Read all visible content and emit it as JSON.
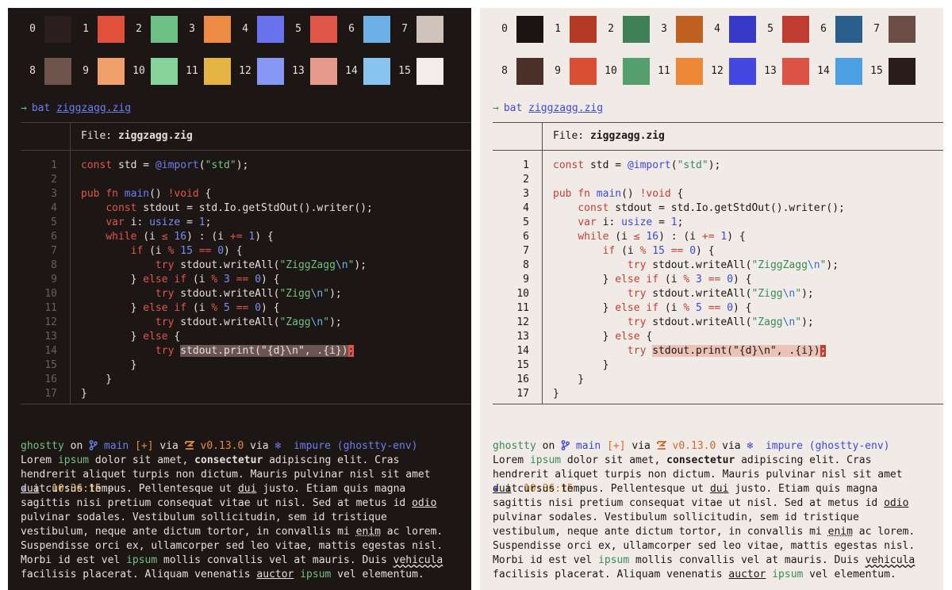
{
  "palette": {
    "dark": {
      "rows": [
        [
          [
            "0",
            "#2a1f1d"
          ],
          [
            "1",
            "#e0503a"
          ],
          [
            "2",
            "#6ec085"
          ],
          [
            "3",
            "#ed8a43"
          ],
          [
            "4",
            "#6673ec"
          ],
          [
            "5",
            "#e0574a"
          ],
          [
            "6",
            "#6cb0e6"
          ],
          [
            "7",
            "#cfc3bc"
          ]
        ],
        [
          [
            "8",
            "#6e544c"
          ],
          [
            "9",
            "#f0a06a"
          ],
          [
            "10",
            "#86d49c"
          ],
          [
            "11",
            "#e6b442"
          ],
          [
            "12",
            "#8797f4"
          ],
          [
            "13",
            "#e69a8b"
          ],
          [
            "14",
            "#88c4ee"
          ],
          [
            "15",
            "#f3ecea"
          ]
        ]
      ]
    },
    "light": {
      "rows": [
        [
          [
            "0",
            "#1c1412"
          ],
          [
            "1",
            "#b63b27"
          ],
          [
            "2",
            "#3f8157"
          ],
          [
            "3",
            "#bf5f22"
          ],
          [
            "4",
            "#3638c8"
          ],
          [
            "5",
            "#be3d30"
          ],
          [
            "6",
            "#2a5e8c"
          ],
          [
            "7",
            "#6a4d45"
          ]
        ],
        [
          [
            "8",
            "#4a3029"
          ],
          [
            "9",
            "#d84f36"
          ],
          [
            "10",
            "#55a06c"
          ],
          [
            "11",
            "#ec8838"
          ],
          [
            "12",
            "#4548e0"
          ],
          [
            "13",
            "#dc5346"
          ],
          [
            "14",
            "#4aa0e2"
          ],
          [
            "15",
            "#2a1c19"
          ]
        ]
      ]
    }
  },
  "command": {
    "arrow": "→",
    "cmd": "bat",
    "file": "ziggzagg.zig"
  },
  "bat": {
    "file_label": "File:",
    "file_name": "ziggzagg.zig"
  },
  "code_lines": [
    [
      [
        "const",
        "kw"
      ],
      [
        " std = ",
        ""
      ],
      [
        "@import",
        "fn"
      ],
      [
        "(",
        ""
      ],
      [
        "\"std\"",
        "str"
      ],
      [
        ");",
        ""
      ]
    ],
    [],
    [
      [
        "pub",
        "kw"
      ],
      [
        " ",
        ""
      ],
      [
        "fn",
        "kw"
      ],
      [
        " ",
        ""
      ],
      [
        "main",
        "fn"
      ],
      [
        "() ",
        ""
      ],
      [
        "!void",
        "kw"
      ],
      [
        " {",
        ""
      ]
    ],
    [
      [
        "    ",
        ""
      ],
      [
        "const",
        "kw"
      ],
      [
        " stdout = std.Io.getStdOut().writer();",
        ""
      ]
    ],
    [
      [
        "    ",
        ""
      ],
      [
        "var",
        "kw"
      ],
      [
        " i: ",
        ""
      ],
      [
        "usize",
        "ty"
      ],
      [
        " = ",
        ""
      ],
      [
        "1",
        "num"
      ],
      [
        ";",
        ""
      ]
    ],
    [
      [
        "    ",
        ""
      ],
      [
        "while",
        "kw"
      ],
      [
        " (i ",
        ""
      ],
      [
        "≤",
        "op"
      ],
      [
        " ",
        ""
      ],
      [
        "16",
        "num"
      ],
      [
        ") : (i ",
        ""
      ],
      [
        "+=",
        "op"
      ],
      [
        " ",
        ""
      ],
      [
        "1",
        "num"
      ],
      [
        ") {",
        ""
      ]
    ],
    [
      [
        "        ",
        ""
      ],
      [
        "if",
        "kw"
      ],
      [
        " (i ",
        ""
      ],
      [
        "%",
        "op"
      ],
      [
        " ",
        ""
      ],
      [
        "15",
        "num"
      ],
      [
        " ",
        ""
      ],
      [
        "==",
        "op"
      ],
      [
        " ",
        ""
      ],
      [
        "0",
        "num"
      ],
      [
        ") {",
        ""
      ]
    ],
    [
      [
        "            ",
        ""
      ],
      [
        "try",
        "kw"
      ],
      [
        " stdout.writeAll(",
        ""
      ],
      [
        "\"ZiggZagg",
        "str"
      ],
      [
        "\\n",
        "esc"
      ],
      [
        "\"",
        "str"
      ],
      [
        ");",
        ""
      ]
    ],
    [
      [
        "        } ",
        ""
      ],
      [
        "else if",
        "kw"
      ],
      [
        " (i ",
        ""
      ],
      [
        "%",
        "op"
      ],
      [
        " ",
        ""
      ],
      [
        "3",
        "num"
      ],
      [
        " ",
        ""
      ],
      [
        "==",
        "op"
      ],
      [
        " ",
        ""
      ],
      [
        "0",
        "num"
      ],
      [
        ") {",
        ""
      ]
    ],
    [
      [
        "            ",
        ""
      ],
      [
        "try",
        "kw"
      ],
      [
        " stdout.writeAll(",
        ""
      ],
      [
        "\"Zigg",
        "str"
      ],
      [
        "\\n",
        "esc"
      ],
      [
        "\"",
        "str"
      ],
      [
        ");",
        ""
      ]
    ],
    [
      [
        "        } ",
        ""
      ],
      [
        "else if",
        "kw"
      ],
      [
        " (i ",
        ""
      ],
      [
        "%",
        "op"
      ],
      [
        " ",
        ""
      ],
      [
        "5",
        "num"
      ],
      [
        " ",
        ""
      ],
      [
        "==",
        "op"
      ],
      [
        " ",
        ""
      ],
      [
        "0",
        "num"
      ],
      [
        ") {",
        ""
      ]
    ],
    [
      [
        "            ",
        ""
      ],
      [
        "try",
        "kw"
      ],
      [
        " stdout.writeAll(",
        ""
      ],
      [
        "\"Zagg",
        "str"
      ],
      [
        "\\n",
        "esc"
      ],
      [
        "\"",
        "str"
      ],
      [
        ");",
        ""
      ]
    ],
    [
      [
        "        } ",
        ""
      ],
      [
        "else",
        "kw"
      ],
      [
        " {",
        ""
      ]
    ],
    [
      [
        "            ",
        ""
      ],
      [
        "try",
        "kw"
      ],
      [
        " ",
        ""
      ],
      [
        "stdout.print(\"{d}\\n\", .{i})",
        "sel"
      ],
      [
        ";",
        "cur"
      ]
    ],
    [
      [
        "        }",
        ""
      ]
    ],
    [
      [
        "    }",
        ""
      ]
    ],
    [
      [
        "}",
        ""
      ]
    ]
  ],
  "status": {
    "dir": "ghostty",
    "on": " on ",
    "branch_icon": "branch-icon",
    "branch": " main",
    "changes": " [+]",
    "via1": " via ",
    "zig_icon": "zig-icon",
    "zig": " v0.13.0",
    "via2": " via ",
    "nix_icon": "snowflake-icon",
    "nix": "  impure (ghostty-env)",
    "at_star": "✦",
    "at": " at ",
    "time": "10:36:15",
    "arrow": " →"
  },
  "lorem": [
    [
      [
        "Lorem ",
        ""
      ],
      [
        "ipsum",
        "green"
      ],
      [
        " dolor sit amet, ",
        ""
      ],
      [
        "consectetur",
        "b"
      ],
      [
        " adipiscing elit. Cras",
        ""
      ]
    ],
    [
      [
        "hendrerit aliquet turpis non dictum. Mauris pulvinar nisl sit amet",
        ""
      ]
    ],
    [
      [
        "dui",
        "u"
      ],
      [
        " cursus tempus. Pellentesque ut ",
        ""
      ],
      [
        "dui",
        "u"
      ],
      [
        " justo. Etiam quis magna",
        ""
      ]
    ],
    [
      [
        "sagittis nisi pretium consequat vitae ut nisl. Sed at metus id ",
        ""
      ],
      [
        "odio",
        "u"
      ]
    ],
    [
      [
        "pulvinar sodales. Vestibulum sollicitudin, sem id tristique",
        ""
      ]
    ],
    [
      [
        "vestibulum, neque ante dictum tortor, in convallis mi ",
        ""
      ],
      [
        "enim",
        "dotted"
      ],
      [
        " ac lorem.",
        ""
      ]
    ],
    [
      [
        "Suspendisse orci ex, ullamcorper sed leo vitae, mattis egestas nisl.",
        ""
      ]
    ],
    [
      [
        "Morbi id est vel ",
        ""
      ],
      [
        "ipsum",
        "green"
      ],
      [
        " mollis convallis vel at mauris. Duis ",
        ""
      ],
      [
        "vehicula",
        "wavy"
      ]
    ],
    [
      [
        "facilisis placerat. Aliquam venenatis ",
        ""
      ],
      [
        "auctor",
        "u"
      ],
      [
        " ",
        ""
      ],
      [
        "ipsum",
        "green"
      ],
      [
        " vel elementum.",
        ""
      ]
    ]
  ]
}
